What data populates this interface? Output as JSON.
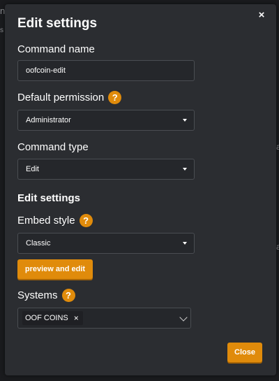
{
  "background": {
    "fragment_left": "n",
    "fragment_left_small": "s",
    "fragment_right_top": "a",
    "fragment_right_bottom": "a"
  },
  "modal": {
    "title": "Edit settings",
    "close_icon": "×",
    "command_name": {
      "label": "Command name",
      "value": "oofcoin-edit"
    },
    "default_permission": {
      "label": "Default permission",
      "help_icon": "?",
      "selected": "Administrator"
    },
    "command_type": {
      "label": "Command type",
      "selected": "Edit"
    },
    "edit_settings_heading": "Edit settings",
    "embed_style": {
      "label": "Embed style",
      "help_icon": "?",
      "selected": "Classic"
    },
    "preview_button_label": "preview and edit",
    "systems": {
      "label": "Systems",
      "help_icon": "?",
      "tags": [
        "OOF COINS"
      ],
      "tag_remove": "×"
    },
    "close_button_label": "Close"
  },
  "colors": {
    "accent": "#e08b0b",
    "modal_bg": "#2b2d31",
    "field_bg": "#25272b",
    "field_border": "#4a4d52"
  }
}
